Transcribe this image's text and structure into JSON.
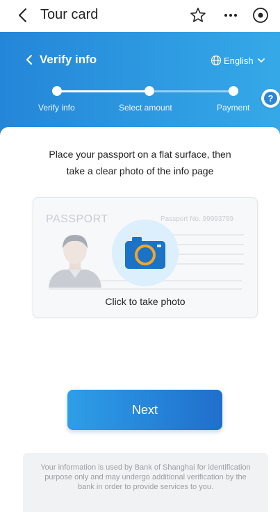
{
  "topbar": {
    "title": "Tour card",
    "icons": [
      "back-arrow-icon",
      "star-icon",
      "more-icon",
      "target-icon"
    ]
  },
  "header": {
    "title": "Verify info",
    "language": "English"
  },
  "steps": [
    {
      "label": "Verify info"
    },
    {
      "label": "Select amount"
    },
    {
      "label": "Payment"
    }
  ],
  "help": {
    "label": "?"
  },
  "instruction": {
    "line1": "Place your passport on a flat surface, then",
    "line2": "take a clear photo of the info page"
  },
  "passport": {
    "title": "PASSPORT",
    "number": "Passport No. 99993789",
    "caption": "Click to take photo"
  },
  "next_button": {
    "label": "Next"
  },
  "disclaimer": {
    "text": "Your information is used by Bank of Shanghai for identification purpose only and may undergo additional verification by the bank in order to provide services to you."
  },
  "colors": {
    "accent": "#2486d8",
    "accent_light": "#35a9e8",
    "button_dark": "#1f6fcc",
    "camera_orange": "#f5a623"
  }
}
